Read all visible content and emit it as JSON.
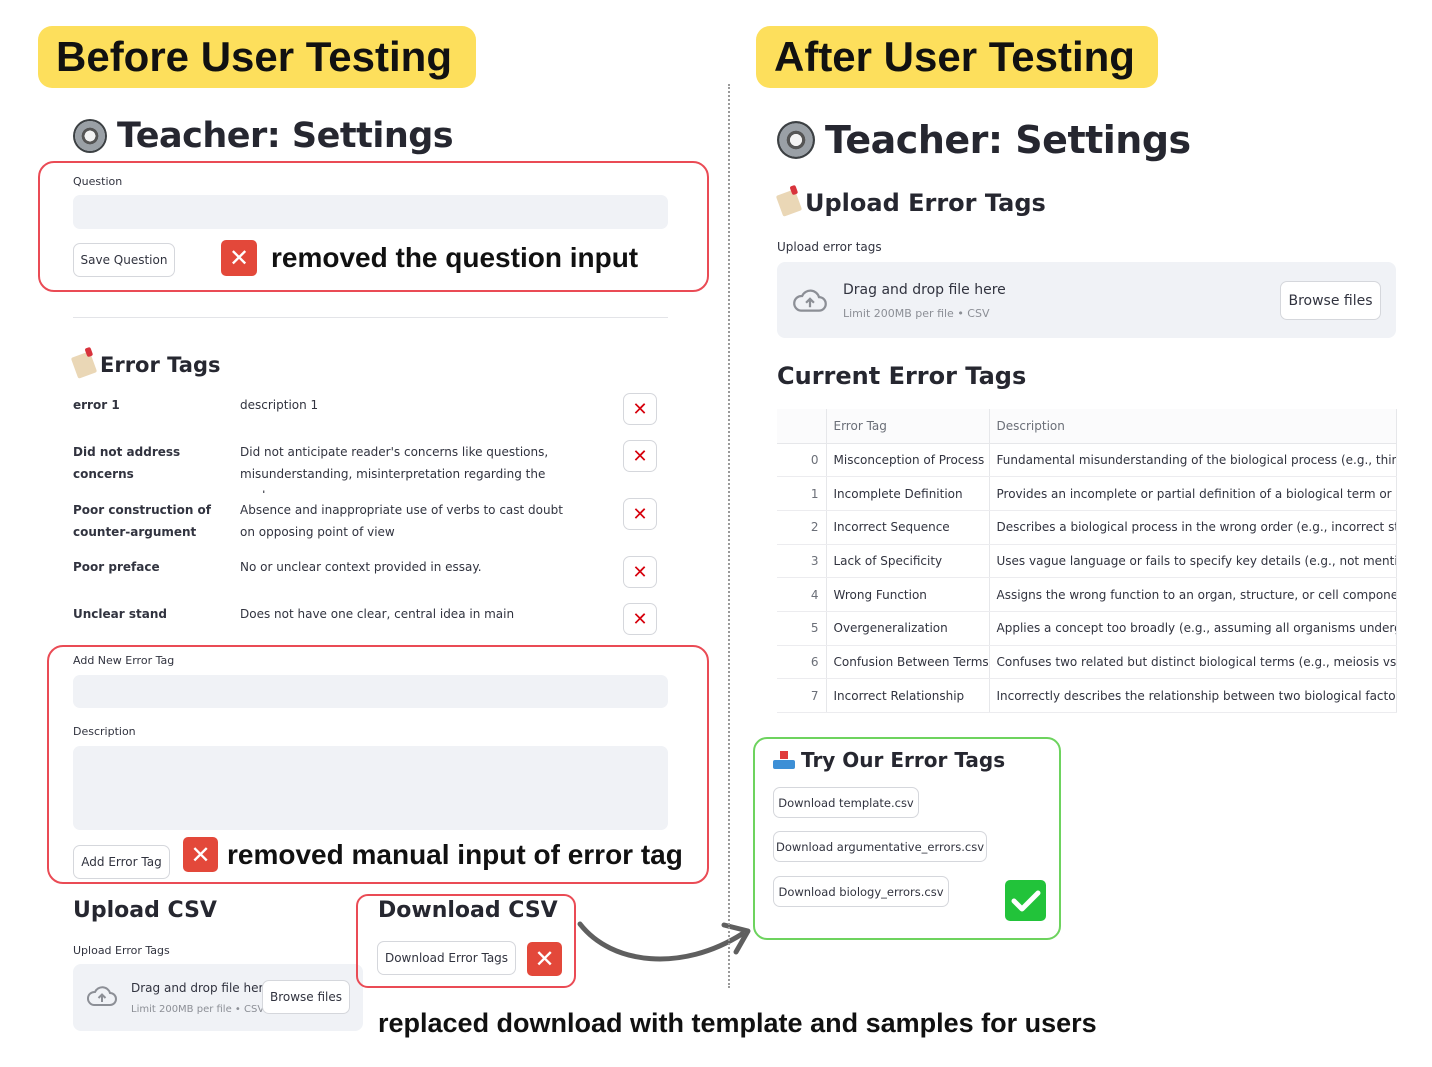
{
  "left": {
    "banner": "Before User Testing",
    "title": "Teacher: Settings",
    "question": {
      "label": "Question",
      "save_button": "Save Question",
      "note": "removed the question input"
    },
    "error_tags": {
      "heading": "Error Tags",
      "rows": [
        {
          "name": "error 1",
          "desc": "description 1"
        },
        {
          "name": "Did not address concerns",
          "desc": "Did not anticipate reader's concerns like questions, misunderstanding, misinterpretation regarding the work"
        },
        {
          "name": "Poor construction of counter-argument",
          "desc": "Absence and inappropriate use of verbs to cast doubt on opposing point of view"
        },
        {
          "name": "Poor preface",
          "desc": "No or unclear context provided in essay."
        },
        {
          "name": "Unclear stand",
          "desc": "Does not have one clear, central idea in main argument"
        }
      ],
      "delete_symbol": "✕"
    },
    "add_tag": {
      "tag_label": "Add New Error Tag",
      "desc_label": "Description",
      "button": "Add Error Tag",
      "note": "removed manual input of error tag"
    },
    "upload": {
      "heading": "Upload CSV",
      "label": "Upload Error Tags",
      "drag_text": "Drag and drop file here",
      "limit_text": "Limit 200MB per file • CSV",
      "browse_button": "Browse files"
    },
    "download": {
      "heading": "Download CSV",
      "button": "Download Error Tags"
    }
  },
  "right": {
    "banner": "After User Testing",
    "title": "Teacher: Settings",
    "upload": {
      "heading": "Upload Error Tags",
      "label": "Upload error tags",
      "drag_text": "Drag and drop file here",
      "limit_text": "Limit 200MB per file • CSV",
      "browse_button": "Browse files"
    },
    "current": {
      "heading": "Current Error Tags",
      "columns": [
        "",
        "Error Tag",
        "Description"
      ],
      "rows": [
        {
          "idx": "0",
          "tag": "Misconception of Process",
          "desc": "Fundamental misunderstanding of the biological process (e.g., thinking"
        },
        {
          "idx": "1",
          "tag": "Incomplete Definition",
          "desc": "Provides an incomplete or partial definition of a biological term or conc"
        },
        {
          "idx": "2",
          "tag": "Incorrect Sequence",
          "desc": "Describes a biological process in the wrong order (e.g., incorrect stages"
        },
        {
          "idx": "3",
          "tag": "Lack of Specificity",
          "desc": "Uses vague language or fails to specify key details (e.g., not mentioning"
        },
        {
          "idx": "4",
          "tag": "Wrong Function",
          "desc": "Assigns the wrong function to an organ, structure, or cell component (e."
        },
        {
          "idx": "5",
          "tag": "Overgeneralization",
          "desc": "Applies a concept too broadly (e.g., assuming all organisms undergo res"
        },
        {
          "idx": "6",
          "tag": "Confusion Between Terms",
          "desc": "Confuses two related but distinct biological terms (e.g., meiosis vs. mito"
        },
        {
          "idx": "7",
          "tag": "Incorrect Relationship",
          "desc": "Incorrectly describes the relationship between two biological factors (e."
        }
      ]
    },
    "try": {
      "heading": "Try Our Error Tags",
      "buttons": [
        "Download template.csv",
        "Download argumentative_errors.csv",
        "Download biology_errors.csv"
      ]
    }
  },
  "footer_note": "replaced download with template and samples for users",
  "colors": {
    "banner": "#fddf5c",
    "red_box": "#ea4b55",
    "green_box": "#6dd35e",
    "red_x": "#e3483a",
    "check": "#22c33a"
  }
}
